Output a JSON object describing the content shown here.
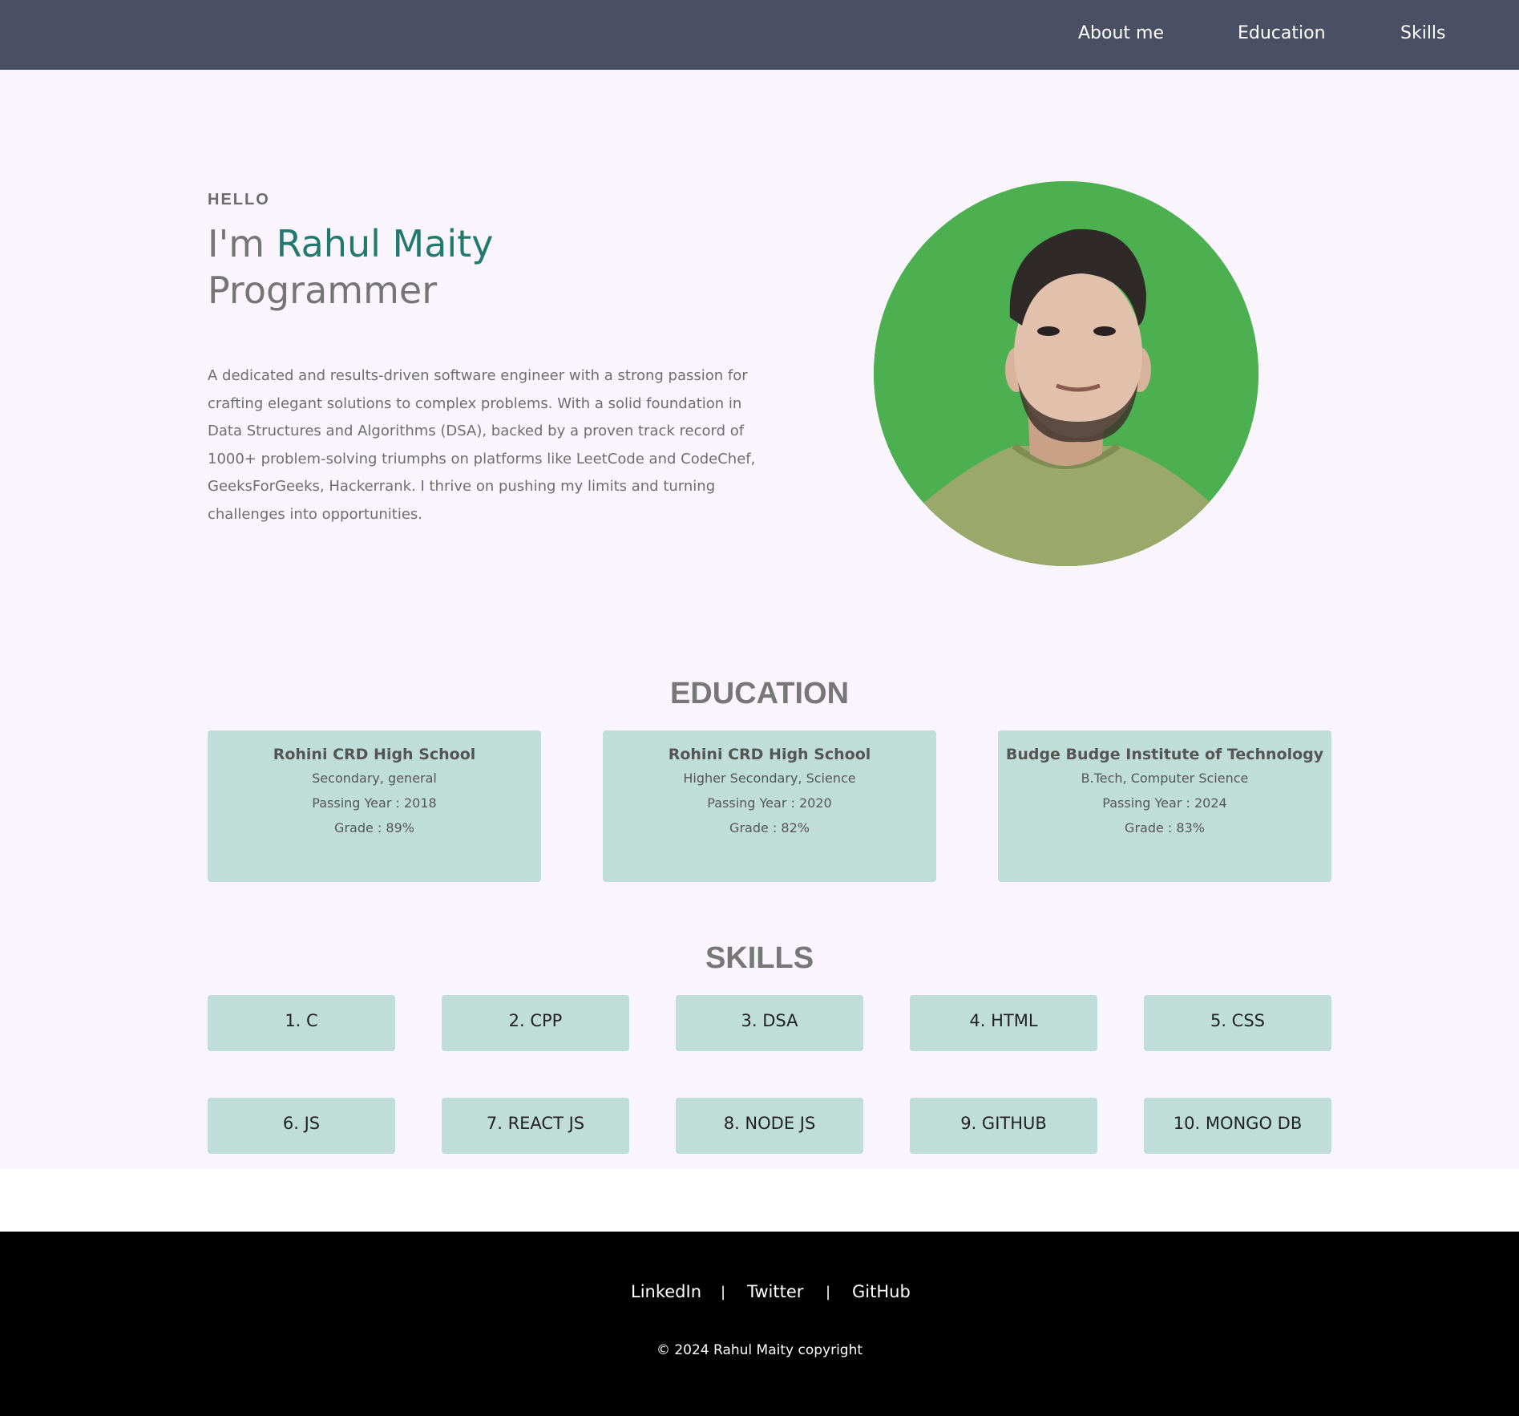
{
  "nav": {
    "links": [
      "About me",
      "Education",
      "Skills"
    ]
  },
  "hero": {
    "greeting": "HELLO",
    "intro_prefix": "I'm ",
    "name": "Rahul Maity",
    "role": "Programmer",
    "bio": "A dedicated and results-driven software engineer with a strong passion for crafting elegant solutions to complex problems. With a solid foundation in Data Structures and Algorithms (DSA), backed by a proven track record of 1000+ problem-solving triumphs on platforms like LeetCode and CodeChef, GeeksForGeeks, Hackerrank. I thrive on pushing my limits and turning challenges into opportunities.",
    "avatar_bg_color": "#4caf50"
  },
  "education": {
    "title": "EDUCATION",
    "cards": [
      {
        "school": "Rohini CRD High School",
        "course": "Secondary, general",
        "passing": "Passing Year : 2018",
        "grade": "Grade : 89%"
      },
      {
        "school": "Rohini CRD High School",
        "course": "Higher Secondary, Science",
        "passing": "Passing Year : 2020",
        "grade": "Grade : 82%"
      },
      {
        "school": "Budge Budge Institute of Technology",
        "course": "B.Tech, Computer Science",
        "passing": "Passing Year : 2024",
        "grade": "Grade : 83%"
      }
    ]
  },
  "skills": {
    "title": "SKILLS",
    "items": [
      "1. C",
      "2. CPP",
      "3. DSA",
      "4. HTML",
      "5. CSS",
      "6. JS",
      "7. REACT JS",
      "8. NODE JS",
      "9. GITHUB",
      "10. MONGO DB"
    ]
  },
  "footer": {
    "links": [
      "LinkedIn",
      "Twitter",
      "GitHub"
    ],
    "separator": "|",
    "copyright": "© 2024 Rahul Maity copyright"
  },
  "colors": {
    "navbar": "#4b4f63",
    "page_bg": "#faf4fd",
    "card_bg": "#c0ded8",
    "name_accent": "#227a6d",
    "footer": "#000000"
  }
}
